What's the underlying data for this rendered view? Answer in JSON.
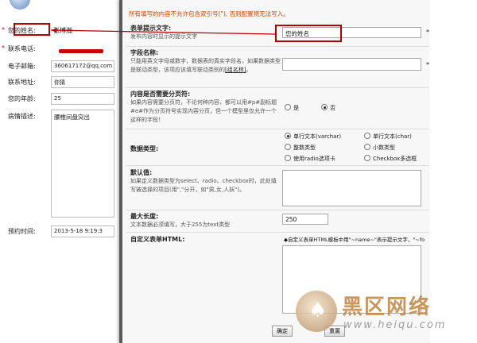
{
  "left_form": {
    "fields": [
      {
        "label": "您的姓名:",
        "value": "张博瀚",
        "required": "*"
      },
      {
        "label": "联系电话:",
        "value": "",
        "required": "*"
      },
      {
        "label": "电子邮箱:",
        "value": "360617172@qq.com",
        "required": ""
      },
      {
        "label": "联系地址:",
        "value": "你猜",
        "required": ""
      },
      {
        "label": "您的年龄:",
        "value": "25",
        "required": ""
      },
      {
        "label": "病情描述:",
        "value": "腰椎间盘突出",
        "required": ""
      },
      {
        "label": "预约时间:",
        "value": "2013-5-18 9:19:3",
        "required": ""
      }
    ]
  },
  "panel": {
    "notice": "所有填写的内容不允许包含双引号(\"), 否则配置将无法写入。",
    "prompt": {
      "title": "表单提示文字:",
      "desc": "发布内容时显示的提示文字",
      "value": "您的姓名",
      "required": "*"
    },
    "field_name": {
      "title": "字段名称:",
      "desc": "只能用英文字母或数字，数据表的真实字段名，如果数据类型是联动类型，该项应该填写联动类别的",
      "link_text": "[组名称]",
      "desc_end": "。",
      "value": "",
      "required": "*"
    },
    "paging": {
      "title": "内容是否需要分页符:",
      "desc": "如果内容需要分页符，不论何种内容，都可以用#p#副标题#e#作为分页符号实现内容分页，但一个模型里仅允许一个这样的字段！",
      "options": [
        {
          "label": "是",
          "checked": false
        },
        {
          "label": "否",
          "checked": true
        }
      ]
    },
    "data_type": {
      "title": "数据类型:",
      "options": [
        {
          "label": "单行文本(varchar)",
          "checked": true
        },
        {
          "label": "单行文本(char)",
          "checked": false
        },
        {
          "label": "整数类型",
          "checked": false
        },
        {
          "label": "小数类型",
          "checked": false
        },
        {
          "label": "使用radio选项卡",
          "checked": false
        },
        {
          "label": "Checkbox多选框",
          "checked": false
        }
      ]
    },
    "default": {
      "title": "默认值:",
      "desc": "如果定义数据类型为select、radio、checkbox时，此处填写被选择的项目(用\",\"分开，如\"男,女,人妖\")。",
      "value": ""
    },
    "max_length": {
      "title": "最大长度:",
      "desc": "文本数据必须填写，大于255为text类型",
      "value": "250"
    },
    "custom_html": {
      "title": "自定义表单HTML:",
      "value": "◆自定义表单HTML模板中用\"~name~\"表示提示文字，\"~fo"
    },
    "buttons": {
      "confirm": "确定",
      "reset": "重置"
    }
  },
  "watermark": {
    "cn": "黑区网络",
    "url": "www.heiqu.com"
  },
  "colors": {
    "annotation_red": "#b40000",
    "notice_orange": "#c84600",
    "redaction_red": "#cc0000"
  }
}
